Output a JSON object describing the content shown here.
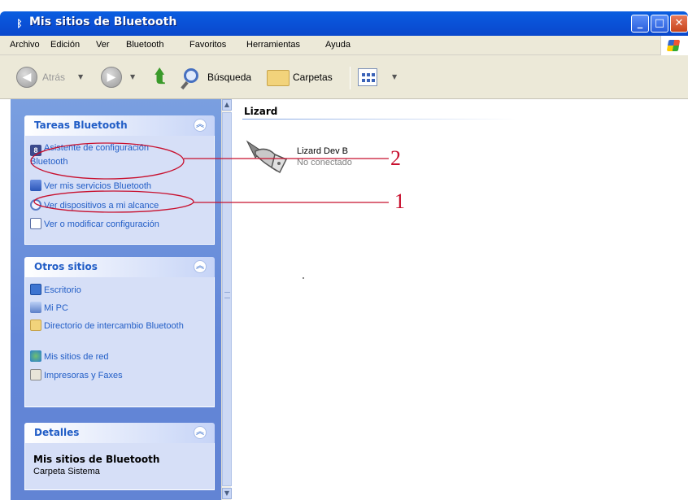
{
  "window": {
    "title": "Mis sitios de Bluetooth",
    "title_icon": "bluetooth-icon"
  },
  "menu": [
    "Archivo",
    "Edición",
    "Ver",
    "Bluetooth",
    "Favoritos",
    "Herramientas",
    "Ayuda"
  ],
  "toolbar": {
    "back": "Atrás",
    "search": "Búsqueda",
    "folders": "Carpetas"
  },
  "tasks": {
    "title": "Tareas Bluetooth",
    "items": [
      {
        "label": "Asistente de configuración Bluetooth",
        "icon": "bluetooth-wizard-icon"
      },
      {
        "label": "Ver mis servicios Bluetooth",
        "icon": "services-icon"
      },
      {
        "label": "Ver dispositivos a mi alcance",
        "icon": "search-devices-icon"
      },
      {
        "label": "Ver o modificar configuración",
        "icon": "settings-icon"
      }
    ]
  },
  "other": {
    "title": "Otros sitios",
    "items": [
      {
        "label": "Escritorio",
        "icon": "desktop-icon"
      },
      {
        "label": "Mi PC",
        "icon": "my-computer-icon"
      },
      {
        "label": "Directorio de intercambio Bluetooth",
        "icon": "folder-icon"
      },
      {
        "label": "Mis sitios de red",
        "icon": "network-icon"
      },
      {
        "label": "Impresoras y Faxes",
        "icon": "printer-icon"
      }
    ]
  },
  "details": {
    "title": "Detalles",
    "name": "Mis sitios de Bluetooth",
    "type": "Carpeta Sistema"
  },
  "content": {
    "group": "Lizard",
    "device_name": "Lizard Dev B",
    "device_status": "No conectado"
  },
  "annotations": {
    "one": "1",
    "two": "2",
    "color": "#c8102e"
  }
}
